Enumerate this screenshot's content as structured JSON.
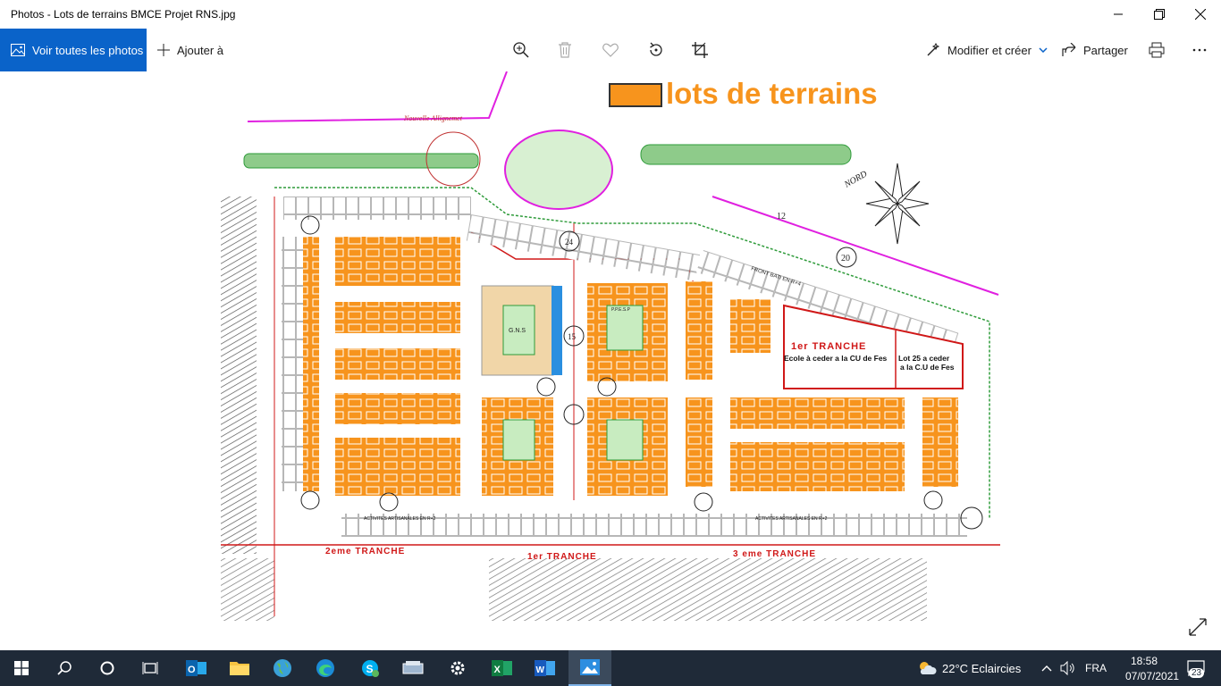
{
  "window": {
    "title": "Photos - Lots de terrains BMCE Projet RNS.jpg"
  },
  "toolbar": {
    "view_all_label": "Voir toutes les photos",
    "add_label": "Ajouter à",
    "edit_create_label": "Modifier et créer",
    "share_label": "Partager"
  },
  "image": {
    "legend_title": "lots de terrains",
    "tranche1_label": "1er TRANCHE",
    "ecole_label": "Ecole à ceder a la CU de Fes",
    "lot25_label_line1": "Lot 25 a ceder",
    "lot25_label_line2": "a la C.U de Fes",
    "tranche2_label": "2eme TRANCHE",
    "tranche1b_label": "1er TRANCHE",
    "tranche3_label": "3 eme TRANCHE",
    "nouvelle_label": "Nouvelle Allignemet",
    "nord_label": "NORD",
    "lot12_label": "12",
    "lot20_label": "20",
    "route15_label": "15",
    "route24_label": "24",
    "activites_label": "ACTIVITES ARTISANALES EN R+2",
    "activites_label2": "ACTIVITES ARTISANALES EN R+2",
    "front_label": "FRONT BATI EN R+4",
    "gns_label": "G.N.S",
    "ppesp_label": "P.P.E.S.P",
    "colors": {
      "lot": "#f7941d",
      "green": "#2e9b3a",
      "pink": "#e020e0",
      "red": "#d01818"
    }
  },
  "taskbar": {
    "weather": "22°C  Eclaircies",
    "lang": "FRA",
    "time": "18:58",
    "date": "07/07/2021",
    "notif_count": "23"
  }
}
